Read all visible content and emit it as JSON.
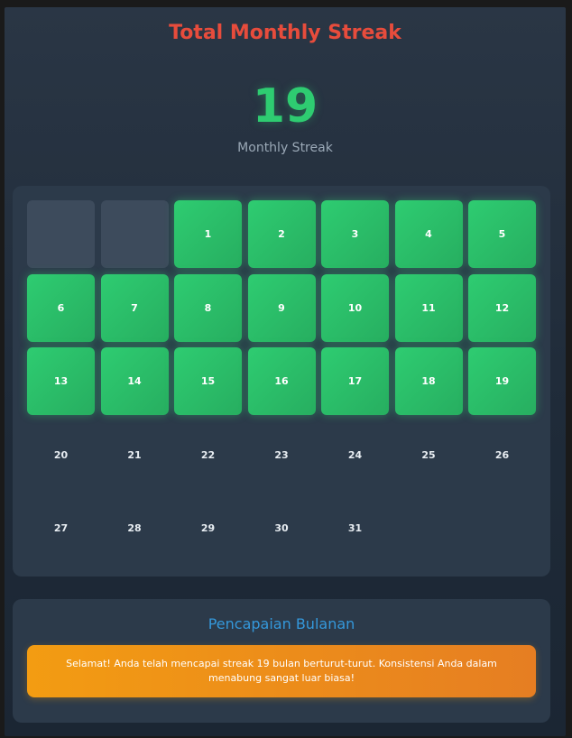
{
  "header": {
    "title": "Total Monthly Streak",
    "streak_count": "19",
    "streak_label": "Monthly Streak"
  },
  "calendar": {
    "leading_empty": 2,
    "completed_through": 19,
    "days": [
      "1",
      "2",
      "3",
      "4",
      "5",
      "6",
      "7",
      "8",
      "9",
      "10",
      "11",
      "12",
      "13",
      "14",
      "15",
      "16",
      "17",
      "18",
      "19",
      "20",
      "21",
      "22",
      "23",
      "24",
      "25",
      "26",
      "27",
      "28",
      "29",
      "30",
      "31"
    ]
  },
  "achievement": {
    "title": "Pencapaian Bulanan",
    "message": "Selamat! Anda telah mencapai streak 19 bulan berturut-turut. Konsistensi Anda dalam menabung sangat luar biasa!"
  },
  "colors": {
    "title": "#e74c3c",
    "streak_number": "#2ecc71",
    "completed_day": "#2ecc71",
    "achievement_title": "#3498db",
    "achievement_banner": "#f39c12"
  }
}
